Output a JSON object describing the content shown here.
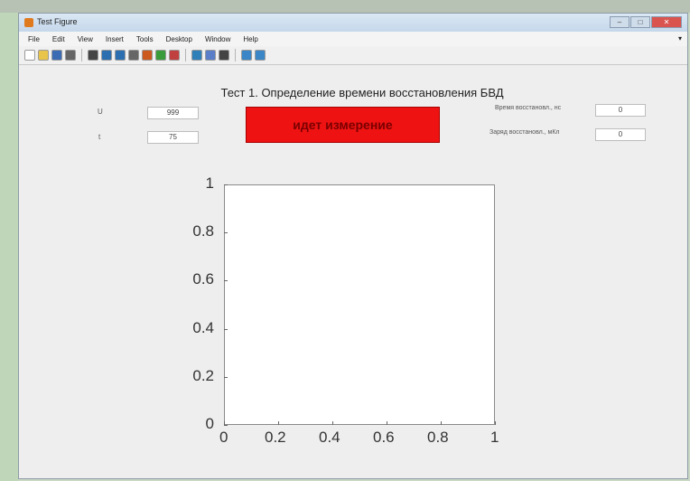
{
  "window": {
    "title": "Test Figure",
    "buttons": {
      "minimize": "–",
      "maximize": "□",
      "close": "✕"
    }
  },
  "menu": {
    "items": [
      "File",
      "Edit",
      "View",
      "Insert",
      "Tools",
      "Desktop",
      "Window",
      "Help"
    ],
    "overflow_arrow": "▾"
  },
  "toolbar": {
    "icons": [
      {
        "name": "new-file-icon",
        "color": "#ffffff"
      },
      {
        "name": "open-folder-icon",
        "color": "#e9c44a"
      },
      {
        "name": "save-icon",
        "color": "#3b6bb3"
      },
      {
        "name": "print-icon",
        "color": "#666666"
      },
      {
        "name": "pointer-icon",
        "color": "#444444"
      },
      {
        "name": "zoom-in-icon",
        "color": "#2b6fb0"
      },
      {
        "name": "zoom-out-icon",
        "color": "#2b6fb0"
      },
      {
        "name": "pan-icon",
        "color": "#666666"
      },
      {
        "name": "rotate-icon",
        "color": "#cc5a1f"
      },
      {
        "name": "data-cursor-icon",
        "color": "#3a9b3a"
      },
      {
        "name": "brush-icon",
        "color": "#c04040"
      },
      {
        "name": "link-icon",
        "color": "#2f7fb8"
      },
      {
        "name": "colorbar-icon",
        "color": "#5a7ec8"
      },
      {
        "name": "legend-icon",
        "color": "#444444"
      },
      {
        "name": "hide-plot-tools-icon",
        "color": "#3b86c6"
      },
      {
        "name": "show-plot-tools-icon",
        "color": "#3b86c6"
      }
    ]
  },
  "figure": {
    "title": "Тест 1. Определение времени восстановления БВД"
  },
  "params": {
    "u_label": "U",
    "u_value": "999",
    "t_label": "t",
    "t_value": "75",
    "recovery_time_label": "Время восстановл., нс",
    "recovery_time_value": "0",
    "recovery_charge_label": "Заряд восстановл., мКл",
    "recovery_charge_value": "0"
  },
  "status": {
    "text": "идет измерение",
    "color": "#ee1212"
  },
  "chart_data": {
    "type": "line",
    "series": [],
    "title": "",
    "xlabel": "",
    "ylabel": "",
    "xlim": [
      0,
      1
    ],
    "ylim": [
      0,
      1
    ],
    "x_ticks": [
      "0",
      "0.2",
      "0.4",
      "0.6",
      "0.8",
      "1"
    ],
    "y_ticks": [
      "0",
      "0.2",
      "0.4",
      "0.6",
      "0.8",
      "1"
    ]
  }
}
